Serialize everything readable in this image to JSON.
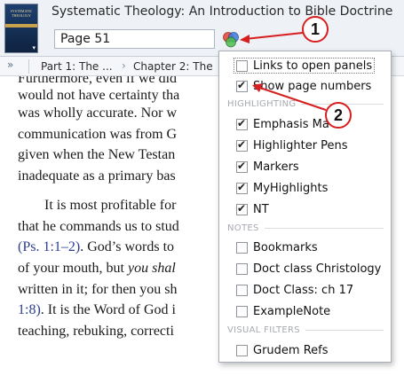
{
  "header": {
    "title": "Systematic Theology: An Introduction to Bible Doctrine",
    "page_value": "Page 51",
    "cover_text": "SYSTEMATIC THEOLOGY"
  },
  "breadcrumb": {
    "chevrons": "»",
    "item1": "Part 1: The ...",
    "arrow": "›",
    "item2": "Chapter 2: The"
  },
  "reading": {
    "lines": [
      "Furthermore, even if we did",
      "would not have certainty tha",
      "was wholly accurate. Nor w",
      "communication was from G",
      "given when the New Testan",
      "inadequate as a primary bas",
      "It is most profitable for",
      "that he commands us to stud",
      "(Ps. 1:1–2). God’s words to",
      "of your mouth, but you shal",
      "written in it; for then you sh",
      "1:8). It is the Word of God i",
      "teaching, rebuking, correcti"
    ],
    "ref1": "(Ps. 1:1–2)",
    "line9_rest": ". God’s words to",
    "line10_a": "of your mouth, but ",
    "line10_b": "you shal",
    "ref2": "1:8)",
    "line12_rest": ". It is the Word of God i"
  },
  "panel": {
    "links_label": "Links to open panels",
    "show_page_numbers": "Show page numbers",
    "sections": {
      "highlighting": "HIGHLIGHTING",
      "notes": "NOTES",
      "visual_filters": "VISUAL FILTERS"
    },
    "highlighting": [
      {
        "label": "Emphasis Ma",
        "checked": true
      },
      {
        "label": "Highlighter Pens",
        "checked": true
      },
      {
        "label": "Markers",
        "checked": true
      },
      {
        "label": "MyHighlights",
        "checked": true
      },
      {
        "label": "NT",
        "checked": true
      }
    ],
    "notes": [
      {
        "label": "Bookmarks",
        "checked": false
      },
      {
        "label": "Doct class Christology",
        "checked": false
      },
      {
        "label": "Doct Class: ch 17",
        "checked": false
      },
      {
        "label": "ExampleNote",
        "checked": false
      }
    ],
    "visual_filters": [
      {
        "label": "Grudem Refs",
        "checked": false
      }
    ]
  },
  "callouts": {
    "one": "1",
    "two": "2"
  },
  "colors": {
    "callout": "#d81f1f",
    "scripture_ref": "#2c3f91"
  }
}
